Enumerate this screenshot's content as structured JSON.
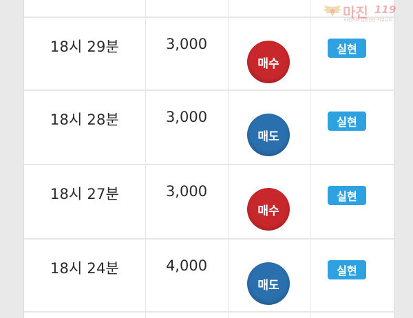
{
  "watermark": {
    "logo_text": "마진",
    "logo_suffix": "119",
    "tagline": "마진거래 검증전문 커뮤니티",
    "color": "#d22b2b"
  },
  "colors": {
    "buy": "#c8282c",
    "sell": "#2a6fae",
    "badge": "#2ea2e0"
  },
  "rows": [
    {
      "time": "18시 29분",
      "amount": "3,000",
      "side": "매수",
      "side_type": "buy",
      "status": "실현"
    },
    {
      "time": "18시 28분",
      "amount": "3,000",
      "side": "매도",
      "side_type": "sell",
      "status": "실현"
    },
    {
      "time": "18시 27분",
      "amount": "3,000",
      "side": "매수",
      "side_type": "buy",
      "status": "실현"
    },
    {
      "time": "18시 24분",
      "amount": "4,000",
      "side": "매도",
      "side_type": "sell",
      "status": "실현"
    }
  ]
}
